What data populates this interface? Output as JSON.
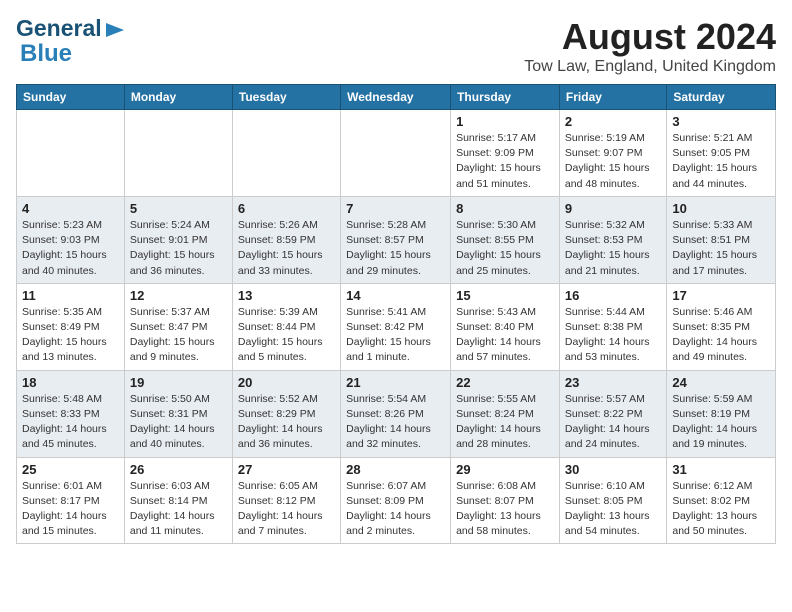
{
  "header": {
    "logo_general": "General",
    "logo_blue": "Blue",
    "title": "August 2024",
    "subtitle": "Tow Law, England, United Kingdom"
  },
  "weekdays": [
    "Sunday",
    "Monday",
    "Tuesday",
    "Wednesday",
    "Thursday",
    "Friday",
    "Saturday"
  ],
  "weeks": [
    [
      {
        "day": "",
        "info": ""
      },
      {
        "day": "",
        "info": ""
      },
      {
        "day": "",
        "info": ""
      },
      {
        "day": "",
        "info": ""
      },
      {
        "day": "1",
        "info": "Sunrise: 5:17 AM\nSunset: 9:09 PM\nDaylight: 15 hours\nand 51 minutes."
      },
      {
        "day": "2",
        "info": "Sunrise: 5:19 AM\nSunset: 9:07 PM\nDaylight: 15 hours\nand 48 minutes."
      },
      {
        "day": "3",
        "info": "Sunrise: 5:21 AM\nSunset: 9:05 PM\nDaylight: 15 hours\nand 44 minutes."
      }
    ],
    [
      {
        "day": "4",
        "info": "Sunrise: 5:23 AM\nSunset: 9:03 PM\nDaylight: 15 hours\nand 40 minutes."
      },
      {
        "day": "5",
        "info": "Sunrise: 5:24 AM\nSunset: 9:01 PM\nDaylight: 15 hours\nand 36 minutes."
      },
      {
        "day": "6",
        "info": "Sunrise: 5:26 AM\nSunset: 8:59 PM\nDaylight: 15 hours\nand 33 minutes."
      },
      {
        "day": "7",
        "info": "Sunrise: 5:28 AM\nSunset: 8:57 PM\nDaylight: 15 hours\nand 29 minutes."
      },
      {
        "day": "8",
        "info": "Sunrise: 5:30 AM\nSunset: 8:55 PM\nDaylight: 15 hours\nand 25 minutes."
      },
      {
        "day": "9",
        "info": "Sunrise: 5:32 AM\nSunset: 8:53 PM\nDaylight: 15 hours\nand 21 minutes."
      },
      {
        "day": "10",
        "info": "Sunrise: 5:33 AM\nSunset: 8:51 PM\nDaylight: 15 hours\nand 17 minutes."
      }
    ],
    [
      {
        "day": "11",
        "info": "Sunrise: 5:35 AM\nSunset: 8:49 PM\nDaylight: 15 hours\nand 13 minutes."
      },
      {
        "day": "12",
        "info": "Sunrise: 5:37 AM\nSunset: 8:47 PM\nDaylight: 15 hours\nand 9 minutes."
      },
      {
        "day": "13",
        "info": "Sunrise: 5:39 AM\nSunset: 8:44 PM\nDaylight: 15 hours\nand 5 minutes."
      },
      {
        "day": "14",
        "info": "Sunrise: 5:41 AM\nSunset: 8:42 PM\nDaylight: 15 hours\nand 1 minute."
      },
      {
        "day": "15",
        "info": "Sunrise: 5:43 AM\nSunset: 8:40 PM\nDaylight: 14 hours\nand 57 minutes."
      },
      {
        "day": "16",
        "info": "Sunrise: 5:44 AM\nSunset: 8:38 PM\nDaylight: 14 hours\nand 53 minutes."
      },
      {
        "day": "17",
        "info": "Sunrise: 5:46 AM\nSunset: 8:35 PM\nDaylight: 14 hours\nand 49 minutes."
      }
    ],
    [
      {
        "day": "18",
        "info": "Sunrise: 5:48 AM\nSunset: 8:33 PM\nDaylight: 14 hours\nand 45 minutes."
      },
      {
        "day": "19",
        "info": "Sunrise: 5:50 AM\nSunset: 8:31 PM\nDaylight: 14 hours\nand 40 minutes."
      },
      {
        "day": "20",
        "info": "Sunrise: 5:52 AM\nSunset: 8:29 PM\nDaylight: 14 hours\nand 36 minutes."
      },
      {
        "day": "21",
        "info": "Sunrise: 5:54 AM\nSunset: 8:26 PM\nDaylight: 14 hours\nand 32 minutes."
      },
      {
        "day": "22",
        "info": "Sunrise: 5:55 AM\nSunset: 8:24 PM\nDaylight: 14 hours\nand 28 minutes."
      },
      {
        "day": "23",
        "info": "Sunrise: 5:57 AM\nSunset: 8:22 PM\nDaylight: 14 hours\nand 24 minutes."
      },
      {
        "day": "24",
        "info": "Sunrise: 5:59 AM\nSunset: 8:19 PM\nDaylight: 14 hours\nand 19 minutes."
      }
    ],
    [
      {
        "day": "25",
        "info": "Sunrise: 6:01 AM\nSunset: 8:17 PM\nDaylight: 14 hours\nand 15 minutes."
      },
      {
        "day": "26",
        "info": "Sunrise: 6:03 AM\nSunset: 8:14 PM\nDaylight: 14 hours\nand 11 minutes."
      },
      {
        "day": "27",
        "info": "Sunrise: 6:05 AM\nSunset: 8:12 PM\nDaylight: 14 hours\nand 7 minutes."
      },
      {
        "day": "28",
        "info": "Sunrise: 6:07 AM\nSunset: 8:09 PM\nDaylight: 14 hours\nand 2 minutes."
      },
      {
        "day": "29",
        "info": "Sunrise: 6:08 AM\nSunset: 8:07 PM\nDaylight: 13 hours\nand 58 minutes."
      },
      {
        "day": "30",
        "info": "Sunrise: 6:10 AM\nSunset: 8:05 PM\nDaylight: 13 hours\nand 54 minutes."
      },
      {
        "day": "31",
        "info": "Sunrise: 6:12 AM\nSunset: 8:02 PM\nDaylight: 13 hours\nand 50 minutes."
      }
    ]
  ]
}
